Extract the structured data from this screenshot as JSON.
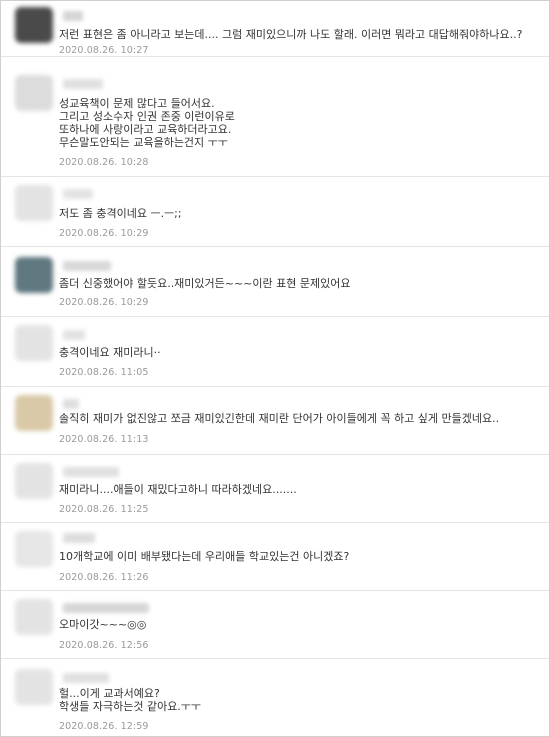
{
  "comments": [
    {
      "text": "저런 표현은 좀 아니라고 보는데.... 그럼 재미있으니까 나도 할래. 이러면 뭐라고 대답해줘야하나요..?",
      "date": "2020.08.26. 10:27",
      "avatar_color": "#4a4a4a"
    },
    {
      "text": "성교육책이 문제 많다고 들어서요.\n그리고 성소수자 인권 존중 이런이유로\n또하나에 사랑이라고 교육하더라고요.\n무슨말도안되는 교육을하는건지 ㅜㅜ",
      "date": "2020.08.26. 10:28",
      "avatar_color": "#dcdcdc"
    },
    {
      "text": "저도 좀 충격이네요 ㅡ.ㅡ;;",
      "date": "2020.08.26. 10:29",
      "avatar_color": "#e3e3e3"
    },
    {
      "text": "좀더 신중했어야 할듯요..재미있거든~~~이란 표현 문제있어요",
      "date": "2020.08.26. 10:29",
      "avatar_color": "#607880"
    },
    {
      "text": "충격이네요 재미라니··",
      "date": "2020.08.26. 11:05",
      "avatar_color": "#e3e3e3"
    },
    {
      "text": "솔직히 재미가 없진않고 쪼금 재미있긴한데 재미란 단어가 아이들에게 꼭 하고 싶게 만들겠네요..",
      "date": "2020.08.26. 11:13",
      "avatar_color": "#d9c9a8"
    },
    {
      "text": "재미라니....애들이 재밌다고하니 따라하겠네요.......",
      "date": "2020.08.26. 11:25",
      "avatar_color": "#e3e3e3"
    },
    {
      "text": "10개학교에 이미 배부됐다는데 우리애들 학교있는건 아니겠죠?",
      "date": "2020.08.26. 11:26",
      "avatar_color": "#e6e6e6"
    },
    {
      "text": "오마이갓~~~◎◎",
      "date": "2020.08.26. 12:56",
      "avatar_color": "#e3e3e3"
    },
    {
      "text": "헐...이게 교과서예요?\n학생들 자극하는것 같아요.ㅜㅜ",
      "date": "2020.08.26. 12:59",
      "avatar_color": "#e3e3e3"
    }
  ]
}
